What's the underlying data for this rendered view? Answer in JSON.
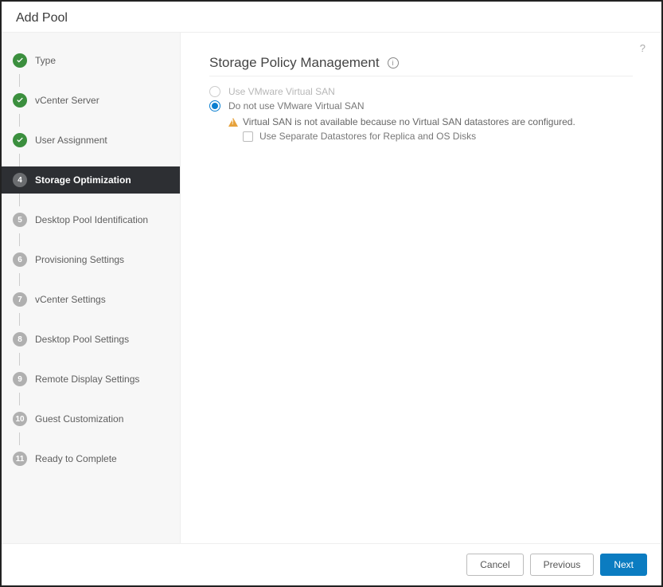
{
  "dialog": {
    "title": "Add Pool"
  },
  "steps": [
    {
      "label": "Type",
      "state": "complete"
    },
    {
      "label": "vCenter Server",
      "state": "complete"
    },
    {
      "label": "User Assignment",
      "state": "complete"
    },
    {
      "label": "Storage Optimization",
      "state": "active"
    },
    {
      "label": "Desktop Pool Identification",
      "state": "pending",
      "num": "5"
    },
    {
      "label": "Provisioning Settings",
      "state": "pending",
      "num": "6"
    },
    {
      "label": "vCenter Settings",
      "state": "pending",
      "num": "7"
    },
    {
      "label": "Desktop Pool Settings",
      "state": "pending",
      "num": "8"
    },
    {
      "label": "Remote Display Settings",
      "state": "pending",
      "num": "9"
    },
    {
      "label": "Guest Customization",
      "state": "pending",
      "num": "10"
    },
    {
      "label": "Ready to Complete",
      "state": "pending",
      "num": "11"
    }
  ],
  "main": {
    "section_title": "Storage Policy Management",
    "radio_use_vsan": "Use VMware Virtual SAN",
    "radio_no_vsan": "Do not use VMware Virtual SAN",
    "warning": "Virtual SAN is not available because no Virtual SAN datastores are configured.",
    "checkbox_separate": "Use Separate Datastores for Replica and OS Disks"
  },
  "buttons": {
    "cancel": "Cancel",
    "previous": "Previous",
    "next": "Next"
  }
}
